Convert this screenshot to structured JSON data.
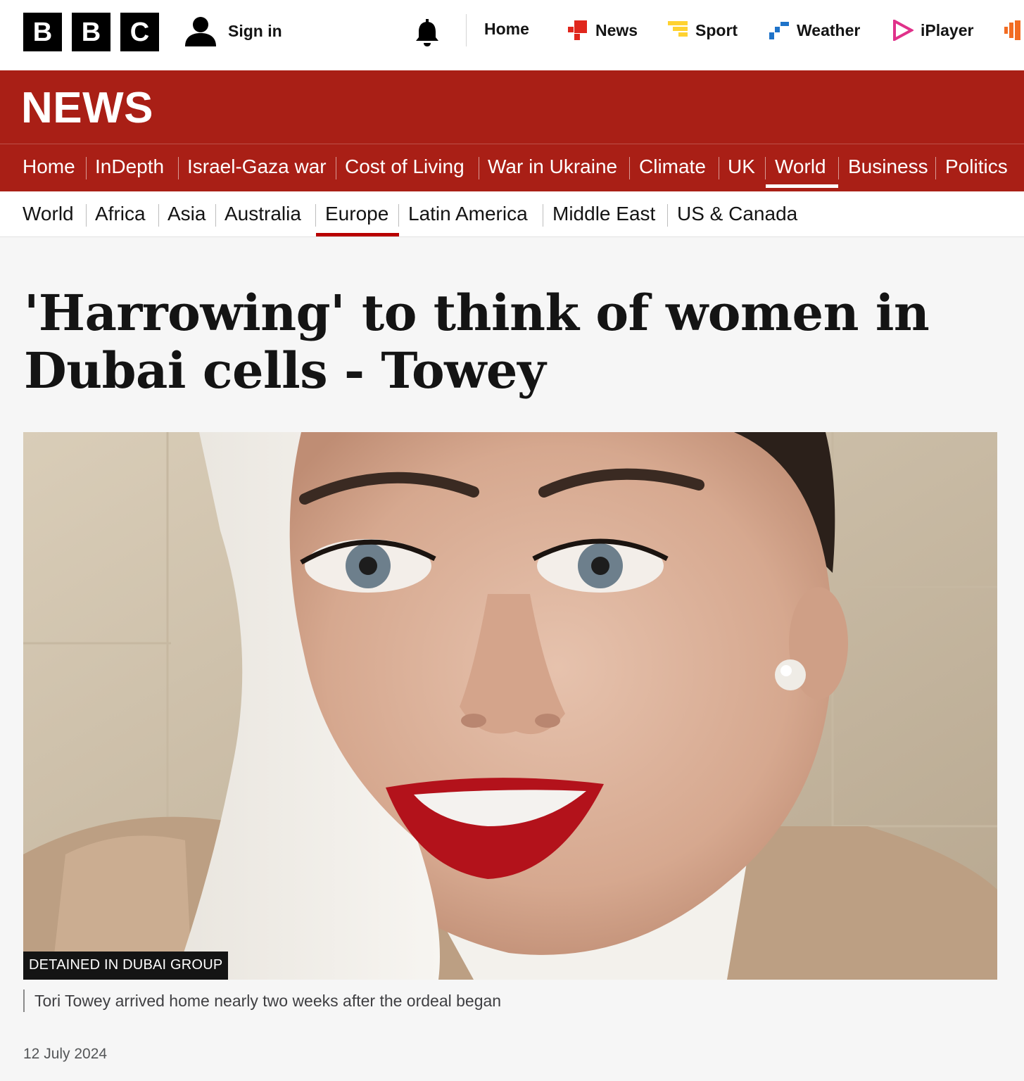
{
  "topbar": {
    "logo_letters": [
      "B",
      "B",
      "C"
    ],
    "sign_in_label": "Sign in",
    "nav": [
      {
        "label": "Home"
      },
      {
        "label": "News"
      },
      {
        "label": "Sport"
      },
      {
        "label": "Weather"
      },
      {
        "label": "iPlayer"
      }
    ]
  },
  "banner": {
    "title": "NEWS"
  },
  "primary_nav": {
    "items": [
      "Home",
      "InDepth",
      "Israel-Gaza war",
      "Cost of Living",
      "War in Ukraine",
      "Climate",
      "UK",
      "World",
      "Business",
      "Politics"
    ],
    "active": "World"
  },
  "secondary_nav": {
    "items": [
      "World",
      "Africa",
      "Asia",
      "Australia",
      "Europe",
      "Latin America",
      "Middle East",
      "US & Canada"
    ],
    "active": "Europe"
  },
  "article": {
    "headline_line1": "'Harrowing' to think of women in",
    "headline_line2": "Dubai cells - Towey",
    "image_credit": "DETAINED IN DUBAI GROUP",
    "caption": "Tori Towey arrived home nearly two weeks after the ordeal began",
    "date": "12 July 2024"
  },
  "colors": {
    "brand_red": "#a91f16",
    "active_underline": "#b80000",
    "news_icon": "#e0261c",
    "sport_icon": "#ffd230",
    "weather_icon": "#1f73c9",
    "iplayer_icon": "#e0318a"
  }
}
